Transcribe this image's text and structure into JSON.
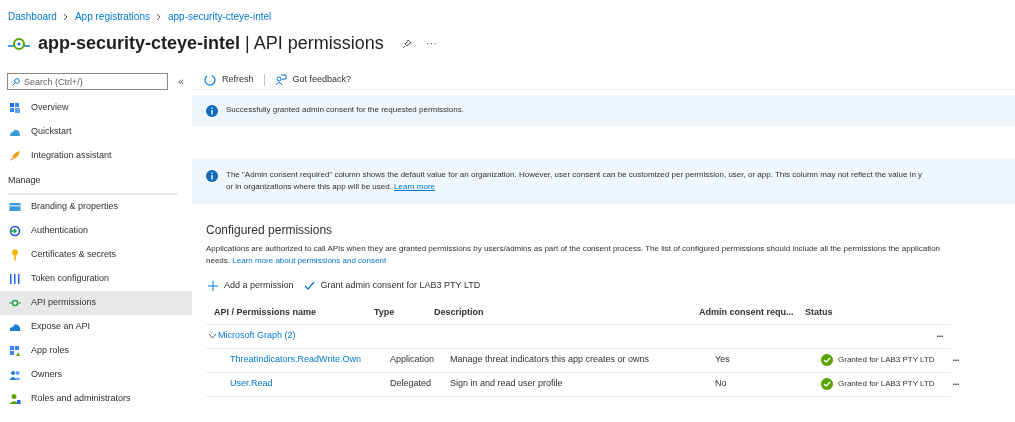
{
  "breadcrumbs": [
    "Dashboard",
    "App registrations",
    "app-security-cteye-intel"
  ],
  "title": {
    "app": "app-security-cteye-intel",
    "separator": "|",
    "page": "API permissions",
    "more": "···"
  },
  "sidebar": {
    "search_placeholder": "Search (Ctrl+/)",
    "collapse": "«",
    "items": [
      {
        "kind": "link",
        "label": "Overview",
        "selected": false
      },
      {
        "kind": "link",
        "label": "Quickstart",
        "selected": false
      },
      {
        "kind": "link",
        "label": "Integration assistant",
        "selected": false
      },
      {
        "kind": "header",
        "label": "Manage"
      },
      {
        "kind": "link",
        "label": "Branding & properties",
        "selected": false
      },
      {
        "kind": "link",
        "label": "Authentication",
        "selected": false
      },
      {
        "kind": "link",
        "label": "Certificates & secrets",
        "selected": false
      },
      {
        "kind": "link",
        "label": "Token configuration",
        "selected": false
      },
      {
        "kind": "link",
        "label": "API permissions",
        "selected": true
      },
      {
        "kind": "link",
        "label": "Expose an API",
        "selected": false
      },
      {
        "kind": "link",
        "label": "App roles",
        "selected": false
      },
      {
        "kind": "link",
        "label": "Owners",
        "selected": false
      },
      {
        "kind": "link",
        "label": "Roles and administrators",
        "selected": false
      }
    ]
  },
  "toolbar": [
    "Refresh",
    "Got feedback?"
  ],
  "banners": [
    {
      "lines": [
        "Successfully granted admin consent for the requested permissions."
      ]
    },
    {
      "lines": [
        "The \"Admin consent required\" column shows the default value for an organization. However, user consent can be customized per permission, user, or app. This column may not reflect the value in y",
        "or in organizations where this app will be used."
      ],
      "link": "Learn more"
    }
  ],
  "configured": {
    "heading": "Configured permissions",
    "text": "Applications are authorized to call APIs when they are granted permissions by users/admins as part of the consent process. The list of configured permissions should include all the permissions the application needs.",
    "link": "Learn more about permissions and consent",
    "actions": [
      "Add a permission",
      "Grant admin consent for LAB3 PTY LTD"
    ],
    "table": {
      "columns": [
        "API / Permissions name",
        "Type",
        "Description",
        "Admin consent requ...",
        "Status"
      ],
      "groups": [
        {
          "name": "Microsoft Graph (2)",
          "expanded": true,
          "more": "•••",
          "rows": [
            {
              "name": "ThreatIndicators.ReadWrite.Own",
              "type": "Application",
              "description": "Manage threat indicators this app creates or owns",
              "admin": "Yes",
              "status": "Granted for LAB3 PTY LTD",
              "more": "•••"
            },
            {
              "name": "User.Read",
              "type": "Delegated",
              "description": "Sign in and read user profile",
              "admin": "No",
              "status": "Granted for LAB3 PTY LTD",
              "more": "•••"
            }
          ]
        }
      ]
    }
  }
}
